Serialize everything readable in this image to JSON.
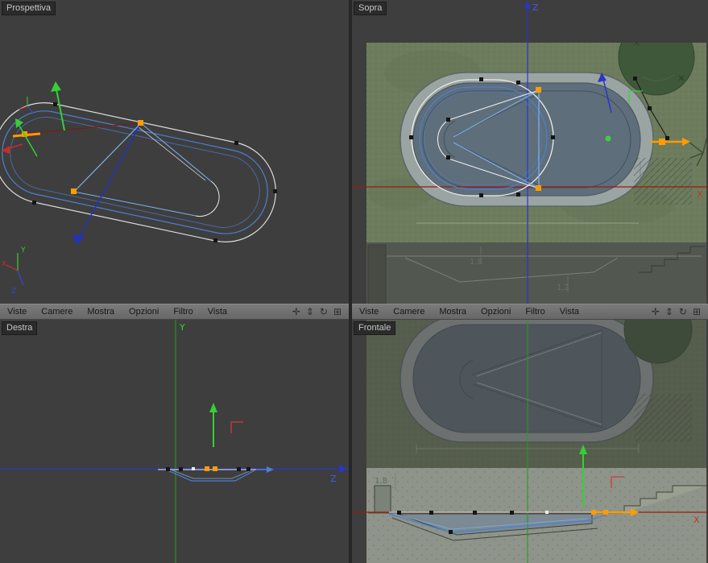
{
  "colors": {
    "accent_orange": "#ff9c00",
    "axis_x_red": "#9b1b10",
    "axis_y_green": "#2fbf2f",
    "axis_z_blue": "#2a35c8",
    "spline_blue": "#4d7fd0",
    "spline_white": "#efefef",
    "origin_dot_green": "#3ecf3e",
    "viewport_bg": "#3e3e3e",
    "menubar_bg": "#707070"
  },
  "menus": {
    "items": [
      "Viste",
      "Camere",
      "Mostra",
      "Opzioni",
      "Filtro",
      "Vista"
    ],
    "icons": [
      {
        "name": "pan-icon",
        "glyph": "✛"
      },
      {
        "name": "dolly-icon",
        "glyph": "⇕"
      },
      {
        "name": "rotate-icon",
        "glyph": "↻"
      },
      {
        "name": "toggle-view-icon",
        "glyph": "⊞"
      }
    ]
  },
  "viewports": {
    "perspective": {
      "label": "Prospettiva",
      "hud": {
        "x": "X",
        "y": "Y",
        "z": "Z"
      }
    },
    "top": {
      "label": "Sopra",
      "axis_z": "Z",
      "axis_x": "X",
      "dims": {
        "left": "1,8",
        "right": "1,2"
      }
    },
    "right_view": {
      "label": "Destra",
      "axis_y": "Y",
      "axis_z": "Z"
    },
    "front": {
      "label": "Frontale",
      "axis_x": "X",
      "dim": "1,8"
    }
  }
}
